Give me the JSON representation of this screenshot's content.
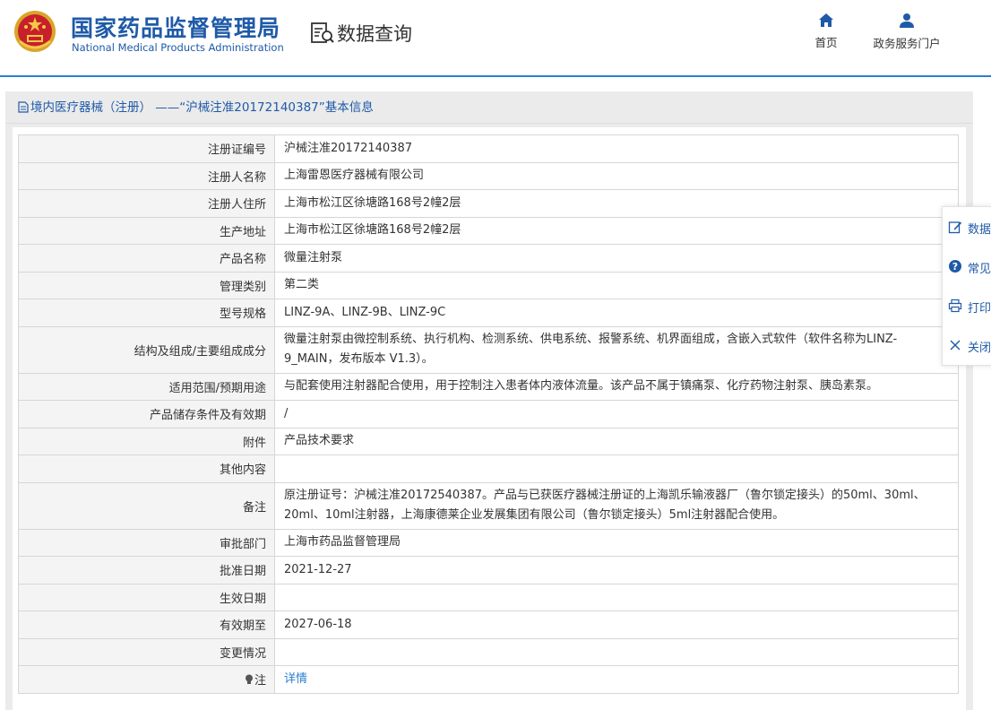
{
  "header": {
    "org_name_cn": "国家药品监督管理局",
    "org_name_en": "National Medical Products Administration",
    "page_title": "数据查询",
    "nav": [
      {
        "label": "首页",
        "icon": "home-icon"
      },
      {
        "label": "政务服务门户",
        "icon": "user-icon"
      }
    ]
  },
  "panel": {
    "title": "境内医疗器械（注册） ——“沪械注准20172140387”基本信息"
  },
  "table": {
    "rows": [
      {
        "label": "注册证编号",
        "value": "沪械注准20172140387"
      },
      {
        "label": "注册人名称",
        "value": "上海雷恩医疗器械有限公司"
      },
      {
        "label": "注册人住所",
        "value": "上海市松江区徐塘路168号2幢2层"
      },
      {
        "label": "生产地址",
        "value": "上海市松江区徐塘路168号2幢2层"
      },
      {
        "label": "产品名称",
        "value": "微量注射泵"
      },
      {
        "label": "管理类别",
        "value": "第二类"
      },
      {
        "label": "型号规格",
        "value": "LINZ-9A、LINZ-9B、LINZ-9C"
      },
      {
        "label": "结构及组成/主要组成成分",
        "value": "微量注射泵由微控制系统、执行机构、检测系统、供电系统、报警系统、机界面组成，含嵌入式软件（软件名称为LINZ-9_MAIN，发布版本 V1.3）。"
      },
      {
        "label": "适用范围/预期用途",
        "value": "与配套使用注射器配合使用，用于控制注入患者体内液体流量。该产品不属于镇痛泵、化疗药物注射泵、胰岛素泵。"
      },
      {
        "label": "产品储存条件及有效期",
        "value": "/"
      },
      {
        "label": "附件",
        "value": "产品技术要求"
      },
      {
        "label": "其他内容",
        "value": ""
      },
      {
        "label": "备注",
        "value": "原注册证号：沪械注准20172540387。产品与已获医疗器械注册证的上海凯乐输液器厂（鲁尔锁定接头）的50ml、30ml、20ml、10ml注射器，上海康德莱企业发展集团有限公司（鲁尔锁定接头）5ml注射器配合使用。"
      },
      {
        "label": "审批部门",
        "value": "上海市药品监督管理局"
      },
      {
        "label": "批准日期",
        "value": "2021-12-27"
      },
      {
        "label": "生效日期",
        "value": ""
      },
      {
        "label": "有效期至",
        "value": "2027-06-18"
      },
      {
        "label": "变更情况",
        "value": ""
      },
      {
        "label": "注",
        "value": "详情"
      }
    ]
  },
  "side": {
    "items": [
      {
        "label": "数据",
        "icon": "edit-icon"
      },
      {
        "label": "常见",
        "icon": "question-icon"
      },
      {
        "label": "打印",
        "icon": "print-icon"
      },
      {
        "label": "关闭",
        "icon": "close-icon"
      }
    ]
  },
  "colors": {
    "brand_blue": "#1f5aa8",
    "link_blue": "#2a7fd0",
    "label_bg": "#f4f4f4",
    "panel_bg": "#ebebeb"
  }
}
